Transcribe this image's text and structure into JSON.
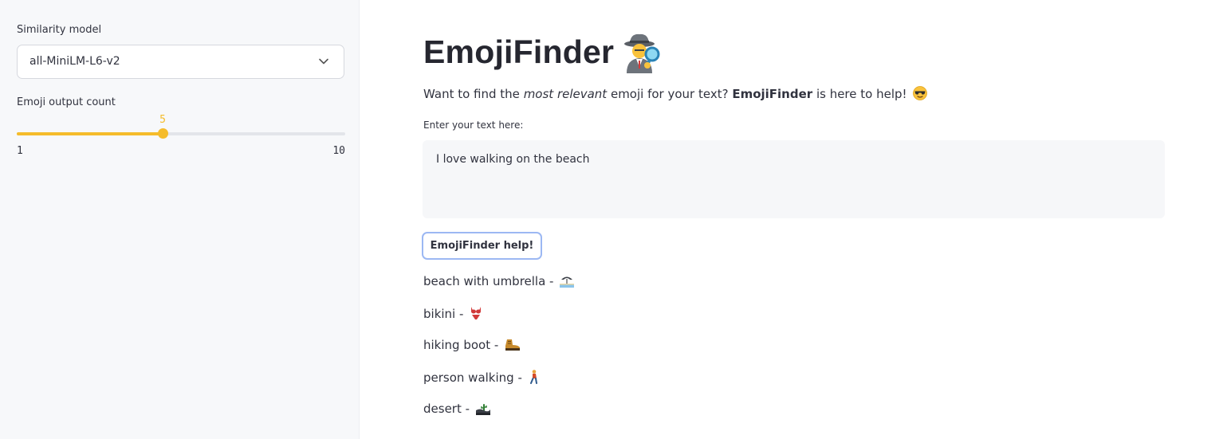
{
  "sidebar": {
    "model_label": "Similarity model",
    "model_value": "all-MiniLM-L6-v2",
    "count_label": "Emoji output count",
    "slider": {
      "current": "5",
      "min": "1",
      "max": "10",
      "fraction": 0.444
    }
  },
  "main": {
    "title": "EmojiFinder",
    "title_icon": "detective-emoji-icon",
    "intro": {
      "part1": "Want to find the ",
      "emphasis": "most relevant",
      "part2": " emoji for your text? ",
      "bold": "EmojiFinder",
      "part3": " is here to help!",
      "icon": "sunglasses-emoji-icon"
    },
    "input_label": "Enter your text here:",
    "input_value": "I love walking on the beach",
    "button_label": "EmojiFinder help!",
    "results": [
      {
        "text": "beach with umbrella - ",
        "icon": "beach-umbrella-emoji-icon"
      },
      {
        "text": "bikini - ",
        "icon": "bikini-emoji-icon"
      },
      {
        "text": "hiking boot - ",
        "icon": "hiking-boot-emoji-icon"
      },
      {
        "text": "person walking - ",
        "icon": "person-walking-emoji-icon"
      },
      {
        "text": "desert - ",
        "icon": "desert-emoji-icon"
      }
    ]
  },
  "colors": {
    "accent": "#f5bc2b",
    "sidebar_bg": "#f7f8fa",
    "button_border": "#9cb8f3",
    "text": "#31333f"
  }
}
